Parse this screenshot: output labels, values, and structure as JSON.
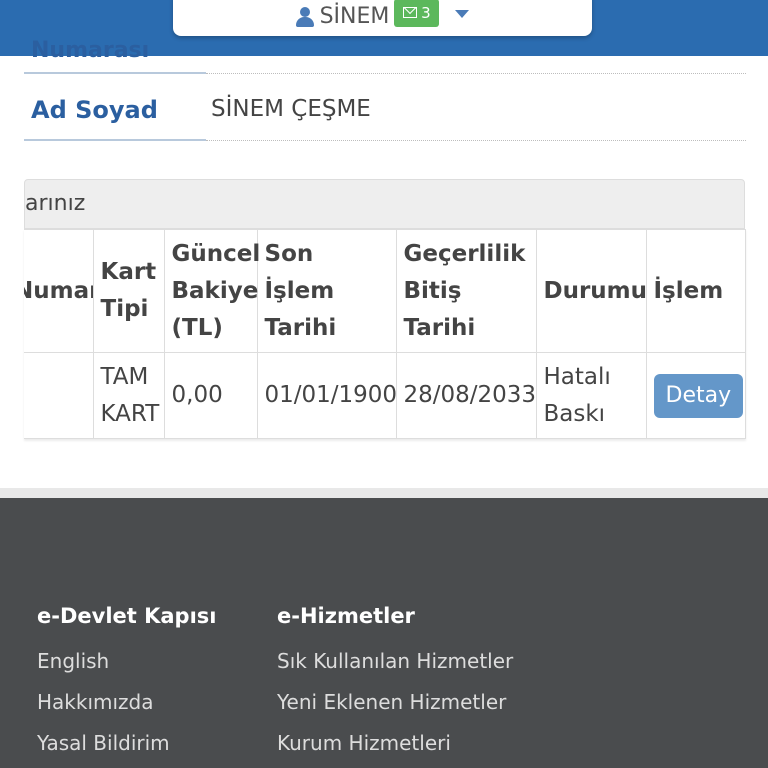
{
  "header": {
    "user_name": "SİNEM",
    "message_count": "3"
  },
  "info": {
    "cut_label": "Numarası",
    "name_label": "Ad Soyad",
    "name_value": "SİNEM ÇEŞME"
  },
  "panel": {
    "title_partial": "arınız"
  },
  "table": {
    "headers": [
      "Numarası",
      "Kart Tipi",
      "Güncel Bakiye (TL)",
      "Son İşlem Tarihi",
      "Geçerlilik Bitiş Tarihi",
      "Durumu",
      "İşlem"
    ],
    "rows": [
      {
        "number": "",
        "card_type": "TAM KART",
        "balance": "0,00",
        "last_transaction": "01/01/1900",
        "expiry": "28/08/2033",
        "status": "Hatalı Baskı",
        "action_label": "Detay"
      }
    ]
  },
  "footer": {
    "col1": {
      "title": "e-Devlet Kapısı",
      "links": [
        "English",
        "Hakkımızda",
        "Yasal Bildirim"
      ]
    },
    "col2": {
      "title": "e-Hizmetler",
      "links": [
        "Sık Kullanılan Hizmetler",
        "Yeni Eklenen Hizmetler",
        "Kurum Hizmetleri"
      ]
    }
  },
  "colors": {
    "brand_blue": "#2b6cb0",
    "label_blue": "#2b5fa0",
    "badge_green": "#5cb85c",
    "button_blue": "#6497c9",
    "footer_bg": "#4a4c4e"
  },
  "icons": {
    "user": "user-icon",
    "messages": "envelope-icon",
    "menu": "caret-down-icon"
  }
}
